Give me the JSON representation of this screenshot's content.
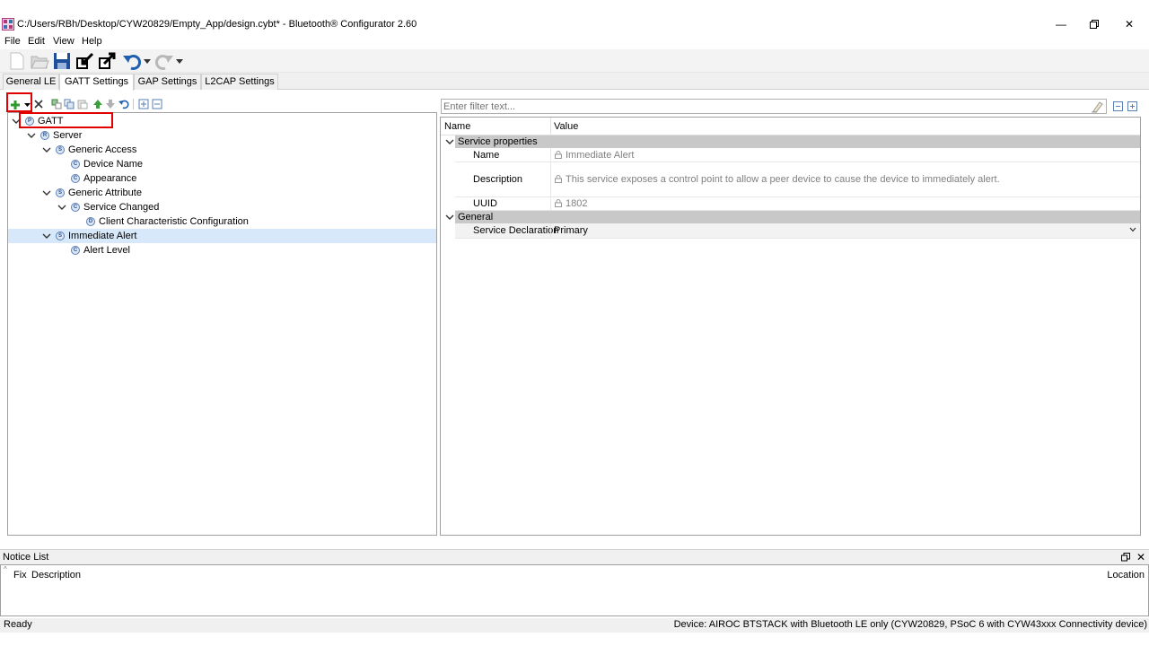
{
  "window": {
    "title": "C:/Users/RBh/Desktop/CYW20829/Empty_App/design.cybt* - Bluetooth® Configurator 2.60"
  },
  "menu": [
    "File",
    "Edit",
    "View",
    "Help"
  ],
  "tabs": [
    "General LE",
    "GATT Settings",
    "GAP Settings",
    "L2CAP Settings"
  ],
  "active_tab": "GATT Settings",
  "tree": {
    "items": [
      {
        "label": "GATT",
        "icon": "profile-icon",
        "letter": "P",
        "level": 0,
        "expanded": true
      },
      {
        "label": "Server",
        "icon": "role-icon",
        "letter": "R",
        "level": 1,
        "expanded": true
      },
      {
        "label": "Generic Access",
        "icon": "service-icon",
        "letter": "S",
        "level": 2,
        "expanded": true
      },
      {
        "label": "Device Name",
        "icon": "characteristic-icon",
        "letter": "C",
        "level": 3
      },
      {
        "label": "Appearance",
        "icon": "characteristic-icon",
        "letter": "C",
        "level": 3
      },
      {
        "label": "Generic Attribute",
        "icon": "service-icon",
        "letter": "S",
        "level": 2,
        "expanded": true
      },
      {
        "label": "Service Changed",
        "icon": "characteristic-icon",
        "letter": "C",
        "level": 3,
        "expanded": true
      },
      {
        "label": "Client Characteristic Configuration",
        "icon": "descriptor-icon",
        "letter": "D",
        "level": 4
      },
      {
        "label": "Immediate Alert",
        "icon": "service-icon",
        "letter": "S",
        "level": 2,
        "expanded": true,
        "selected": true
      },
      {
        "label": "Alert Level",
        "icon": "characteristic-icon",
        "letter": "C",
        "level": 3
      }
    ]
  },
  "filter": {
    "placeholder": "Enter filter text..."
  },
  "properties": {
    "col_name": "Name",
    "col_value": "Value",
    "groups": [
      {
        "label": "Service properties",
        "rows": [
          {
            "name": "Name",
            "value": "Immediate Alert",
            "readonly": true
          },
          {
            "name": "Description",
            "value": "This service exposes a control point to allow a peer device to cause the device to immediately alert.",
            "readonly": true
          },
          {
            "name": "UUID",
            "value": "1802",
            "readonly": true
          }
        ]
      },
      {
        "label": "General",
        "rows": [
          {
            "name": "Service Declaration",
            "value": "Primary",
            "readonly": false
          }
        ]
      }
    ]
  },
  "notice": {
    "title": "Notice List",
    "col_fix": "Fix",
    "col_description": "Description",
    "col_location": "Location"
  },
  "status": {
    "left": "Ready",
    "right": "Device: AIROC BTSTACK with Bluetooth LE only (CYW20829, PSoC 6 with CYW43xxx Connectivity device)"
  },
  "colors": {
    "selection": "#d6e8f9",
    "highlight_box": "#e00000",
    "group_bar": "#c8c8c8"
  }
}
